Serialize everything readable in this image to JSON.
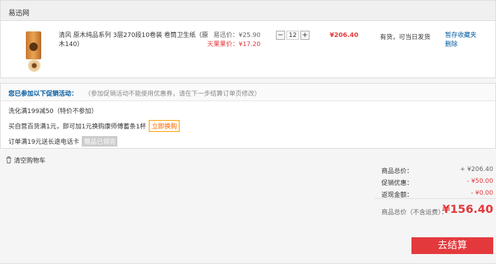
{
  "shop": {
    "name": "易迅网"
  },
  "item": {
    "title": "清风 原木纯品系列 3层270段10卷装 卷筒卫生纸（原木140）",
    "price_yx_label": "易迅价：¥25.90",
    "price_tm_label": "天果果价：¥17.20",
    "qty_minus": "−",
    "qty_value": "12",
    "qty_plus": "+",
    "subtotal": "¥206.40",
    "stock": "有货，可当日发货",
    "action_save": "暂存收藏夹",
    "action_delete": "删除"
  },
  "promo": {
    "title": "您已参加以下促销活动：",
    "note": "（参加促销活动不能使用优惠券，请在下一步结算订单页修改）",
    "line1": "洗化满199减50（特价不参加）",
    "line2": "买自营百货满1元，即可加1元换购康师傅蓄条1杯",
    "line2_button": "立即换购",
    "line3": "订单满19元送长途电话卡",
    "line3_tag": "赠品已领完"
  },
  "cart": {
    "clear_label": "清空购物车"
  },
  "summary": {
    "goods_total_label": "商品总价：",
    "goods_total_value": "+ ¥206.40",
    "promo_label": "促销优惠：",
    "promo_value": "- ¥50.00",
    "cashback_label": "返现金额：",
    "cashback_value": "- ¥0.00",
    "grand_label": "商品总价（不含运费）：",
    "grand_value": "¥156.40"
  },
  "checkout": {
    "label": "去结算"
  },
  "colors": {
    "accent": "#e4393c",
    "link": "#005aa0",
    "orange": "#ff6600"
  }
}
